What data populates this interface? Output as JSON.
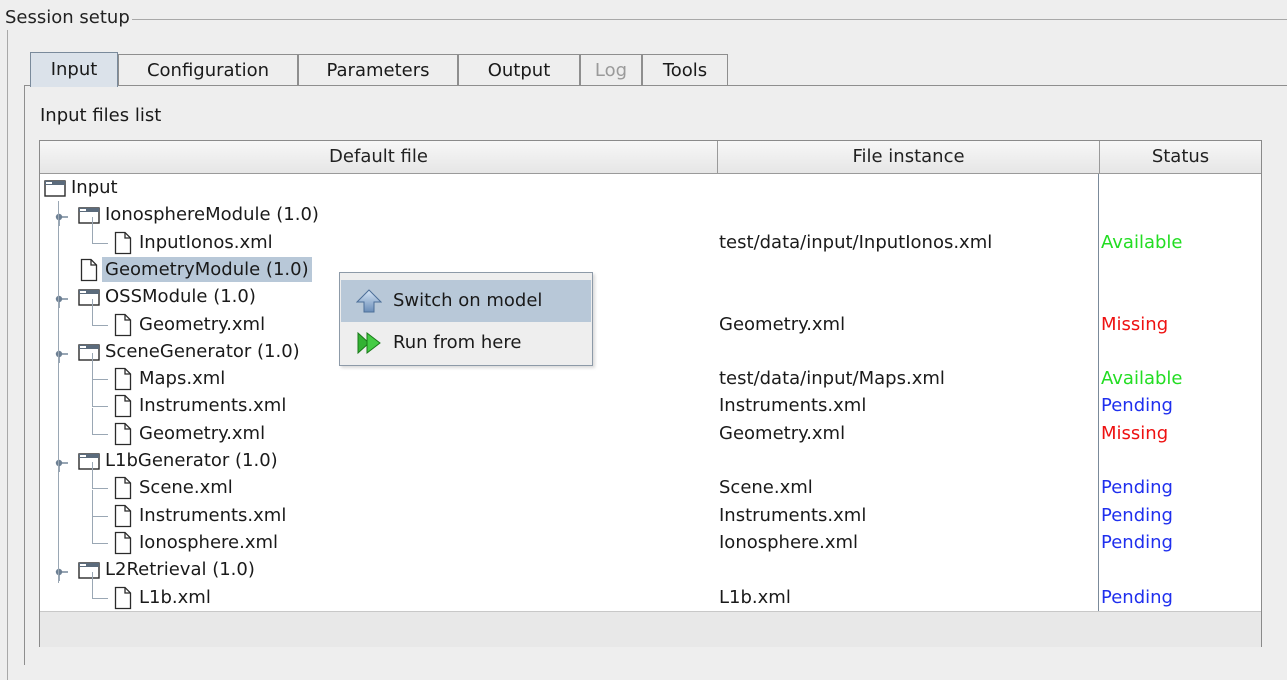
{
  "group": {
    "title": "Session setup"
  },
  "tabs": [
    {
      "label": "Input",
      "selected": true,
      "enabled": true
    },
    {
      "label": "Configuration",
      "selected": false,
      "enabled": true
    },
    {
      "label": "Parameters",
      "selected": false,
      "enabled": true
    },
    {
      "label": "Output",
      "selected": false,
      "enabled": true
    },
    {
      "label": "Log",
      "selected": false,
      "enabled": false
    },
    {
      "label": "Tools",
      "selected": false,
      "enabled": true
    }
  ],
  "panel": {
    "label": "Input files list"
  },
  "table": {
    "columns": [
      "Default file",
      "File instance",
      "Status"
    ],
    "rows": [
      {
        "name": "Input",
        "kind": "folder",
        "depth": 0,
        "instance": "",
        "status": ""
      },
      {
        "name": "IonosphereModule (1.0)",
        "kind": "folder",
        "depth": 1,
        "instance": "",
        "status": ""
      },
      {
        "name": "InputIonos.xml",
        "kind": "file",
        "depth": 2,
        "instance": "test/data/input/InputIonos.xml",
        "status": "Available"
      },
      {
        "name": "GeometryModule (1.0)",
        "kind": "file",
        "depth": 1,
        "instance": "",
        "status": "",
        "selected": true
      },
      {
        "name": "OSSModule (1.0)",
        "kind": "folder",
        "depth": 1,
        "instance": "",
        "status": ""
      },
      {
        "name": "Geometry.xml",
        "kind": "file",
        "depth": 2,
        "instance": "Geometry.xml",
        "status": "Missing"
      },
      {
        "name": "SceneGenerator (1.0)",
        "kind": "folder",
        "depth": 1,
        "instance": "",
        "status": ""
      },
      {
        "name": "Maps.xml",
        "kind": "file",
        "depth": 2,
        "instance": "test/data/input/Maps.xml",
        "status": "Available"
      },
      {
        "name": "Instruments.xml",
        "kind": "file",
        "depth": 2,
        "instance": "Instruments.xml",
        "status": "Pending"
      },
      {
        "name": "Geometry.xml",
        "kind": "file",
        "depth": 2,
        "instance": "Geometry.xml",
        "status": "Missing"
      },
      {
        "name": "L1bGenerator (1.0)",
        "kind": "folder",
        "depth": 1,
        "instance": "",
        "status": ""
      },
      {
        "name": "Scene.xml",
        "kind": "file",
        "depth": 2,
        "instance": "Scene.xml",
        "status": "Pending"
      },
      {
        "name": "Instruments.xml",
        "kind": "file",
        "depth": 2,
        "instance": "Instruments.xml",
        "status": "Pending"
      },
      {
        "name": "Ionosphere.xml",
        "kind": "file",
        "depth": 2,
        "instance": "Ionosphere.xml",
        "status": "Pending"
      },
      {
        "name": "L2Retrieval (1.0)",
        "kind": "folder",
        "depth": 1,
        "instance": "",
        "status": ""
      },
      {
        "name": "L1b.xml",
        "kind": "file",
        "depth": 2,
        "instance": "L1b.xml",
        "status": "Pending"
      }
    ]
  },
  "status_colors": {
    "Available": "#22dd22",
    "Missing": "#ee1111",
    "Pending": "#1f2fee"
  },
  "context_menu": {
    "items": [
      {
        "label": "Switch on model",
        "icon": "up-arrow-icon",
        "hover": true
      },
      {
        "label": "Run from here",
        "icon": "run-forward-icon",
        "hover": false
      }
    ]
  }
}
